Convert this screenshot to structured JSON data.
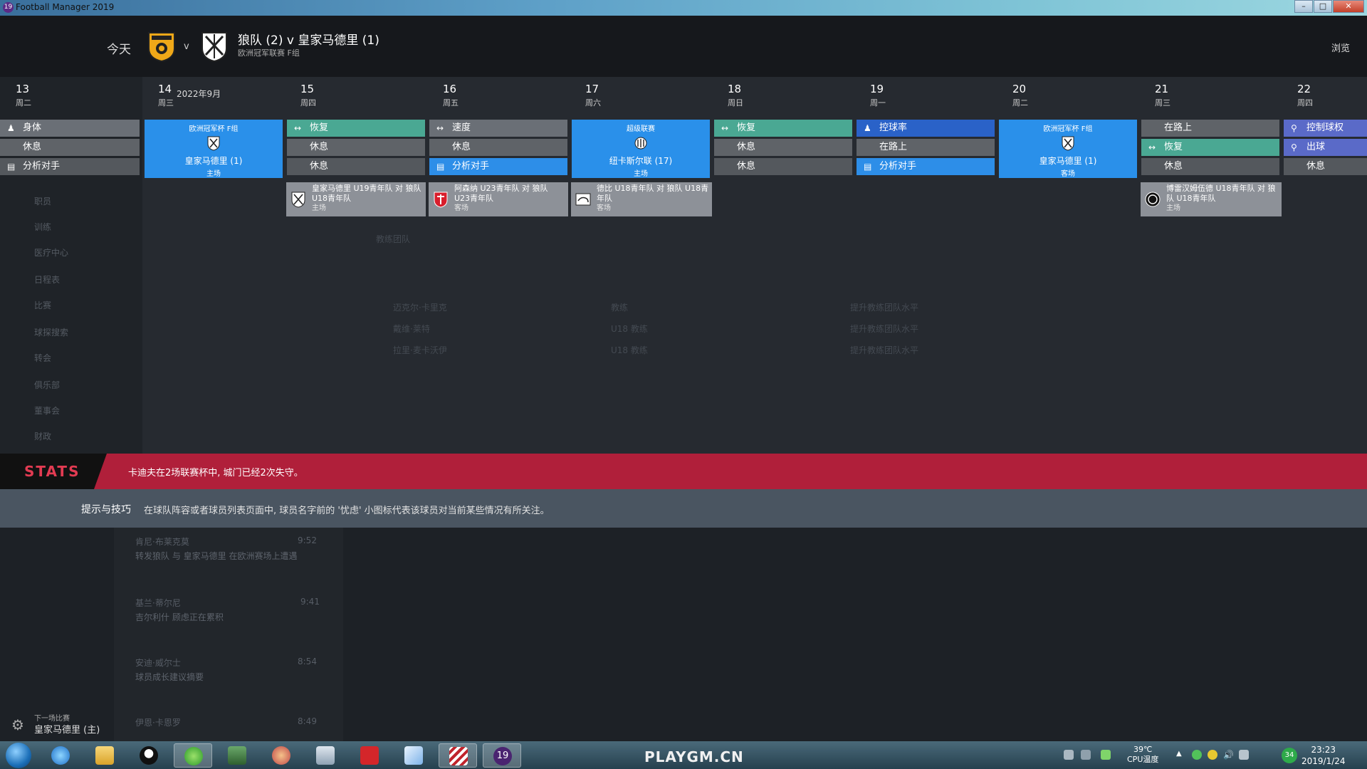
{
  "window": {
    "title": "Football Manager 2019",
    "app_badge": "19"
  },
  "header": {
    "today": "今天",
    "vs": "v",
    "match_title": "狼队 (2) v 皇家马德里 (1)",
    "competition": "欧洲冠军联赛 F组",
    "browse": "浏览"
  },
  "calendar": {
    "month": "2022年9月",
    "days": [
      {
        "num": "13",
        "weekday": "周二"
      },
      {
        "num": "14",
        "weekday": "周三"
      },
      {
        "num": "15",
        "weekday": "周四"
      },
      {
        "num": "16",
        "weekday": "周五"
      },
      {
        "num": "17",
        "weekday": "周六"
      },
      {
        "num": "18",
        "weekday": "周日"
      },
      {
        "num": "19",
        "weekday": "周一"
      },
      {
        "num": "20",
        "weekday": "周二"
      },
      {
        "num": "21",
        "weekday": "周三"
      },
      {
        "num": "22",
        "weekday": "周四"
      }
    ],
    "sessions": {
      "d13": [
        "身体",
        "休息",
        "分析对手"
      ],
      "d15": [
        "恢复",
        "休息",
        "休息"
      ],
      "d16": [
        "速度",
        "休息",
        "分析对手"
      ],
      "d18": [
        "恢复",
        "休息",
        "休息"
      ],
      "d19": [
        "控球率",
        "在路上",
        "分析对手"
      ],
      "d21": [
        "在路上",
        "恢复",
        "休息"
      ],
      "d22": [
        "控制球权",
        "出球",
        "休息"
      ]
    },
    "matches": {
      "d14": {
        "comp": "欧洲冠军杯 F组",
        "opponent": "皇家马德里 (1)",
        "venue": "主场"
      },
      "d17": {
        "comp": "超级联赛",
        "opponent": "纽卡斯尔联 (17)",
        "venue": "主场"
      },
      "d20": {
        "comp": "欧洲冠军杯 F组",
        "opponent": "皇家马德里 (1)",
        "venue": "客场"
      }
    },
    "youth": [
      {
        "title": "皇家马德里 U19青年队 对 狼队 U18青年队",
        "venue": "主场"
      },
      {
        "title": "阿森纳 U23青年队 对 狼队 U23青年队",
        "venue": "客场"
      },
      {
        "title": "德比 U18青年队 对 狼队 U18青年队",
        "venue": "客场"
      },
      {
        "title": "博雷汉姆伍德 U18青年队 对 狼队 U18青年队",
        "venue": "主场"
      }
    ]
  },
  "ghost": {
    "sidebar": [
      "职员",
      "训练",
      "医疗中心",
      "日程表",
      "比赛",
      "球探搜索",
      "转会",
      "俱乐部",
      "董事会",
      "财政"
    ],
    "coaching_title": "教练团队",
    "staff": [
      {
        "name": "迈克尔·卡里克",
        "role": "教练",
        "action": "提升教练团队水平"
      },
      {
        "name": "戴维·莱特",
        "role": "U18 教练",
        "action": "提升教练团队水平"
      },
      {
        "name": "拉里·麦卡沃伊",
        "role": "U18 教练",
        "action": "提升教练团队水平"
      }
    ]
  },
  "stats_bar": {
    "logo": "STATS",
    "text": "卡迪夫在2场联赛杯中, 城门已经2次失守。"
  },
  "tips": {
    "label": "提示与技巧",
    "text": "在球队阵容或者球员列表页面中, 球员名字前的 '忧虑' 小图标代表该球员对当前某些情况有所关注。"
  },
  "feed": [
    {
      "who": "肯尼·布莱克莫",
      "time": "9:52",
      "text": "转发狼队 与 皇家马德里 在欧洲赛场上遭遇"
    },
    {
      "who": "基兰·蒂尔尼",
      "time": "9:41",
      "text": "吉尔利什 顾虑正在累积"
    },
    {
      "who": "安迪·威尔士",
      "time": "8:54",
      "text": "球员成长建议摘要"
    },
    {
      "who": "伊恩·卡恩罗",
      "time": "8:49",
      "text": ""
    }
  ],
  "next_match": {
    "label": "下一场比赛",
    "value": "皇家马德里 (主)"
  },
  "taskbar": {
    "watermark": "PLAYGM.CN",
    "temp": "39℃",
    "temp_label": "CPU温度",
    "time": "23:23",
    "date": "2019/1/24",
    "badge": "34"
  },
  "colors": {
    "stats_red": "#b01f3a",
    "session_blue": "#2d8ee8",
    "teal": "#4aa893"
  }
}
